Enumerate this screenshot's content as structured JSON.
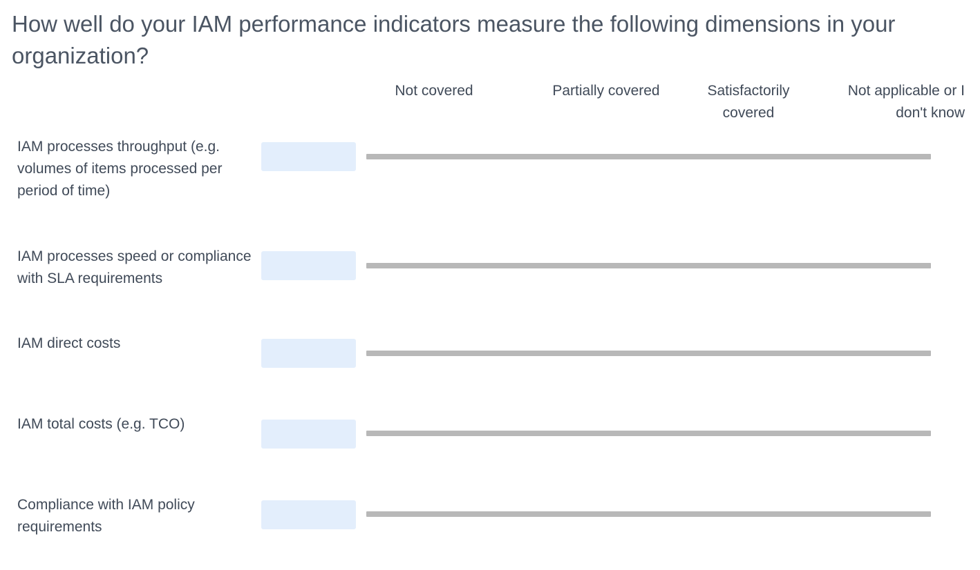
{
  "question": {
    "title": "How well do your IAM performance indicators measure the following dimensions in your organization?"
  },
  "scale": {
    "labels": [
      "Not covered",
      "Partially covered",
      "Satisfactorily covered",
      "Not applicable or I don't know"
    ]
  },
  "rows": [
    {
      "label": "IAM processes throughput (e.g. volumes of items processed per period of time)",
      "value": ""
    },
    {
      "label": "IAM processes speed or compliance with SLA requirements",
      "value": ""
    },
    {
      "label": "IAM direct costs",
      "value": ""
    },
    {
      "label": "IAM total costs (e.g. TCO)",
      "value": ""
    },
    {
      "label": "Compliance with IAM policy requirements",
      "value": ""
    }
  ],
  "colors": {
    "value_box": "#e3eefc",
    "slider_track": "#b8b8b8",
    "text": "#404a58"
  }
}
